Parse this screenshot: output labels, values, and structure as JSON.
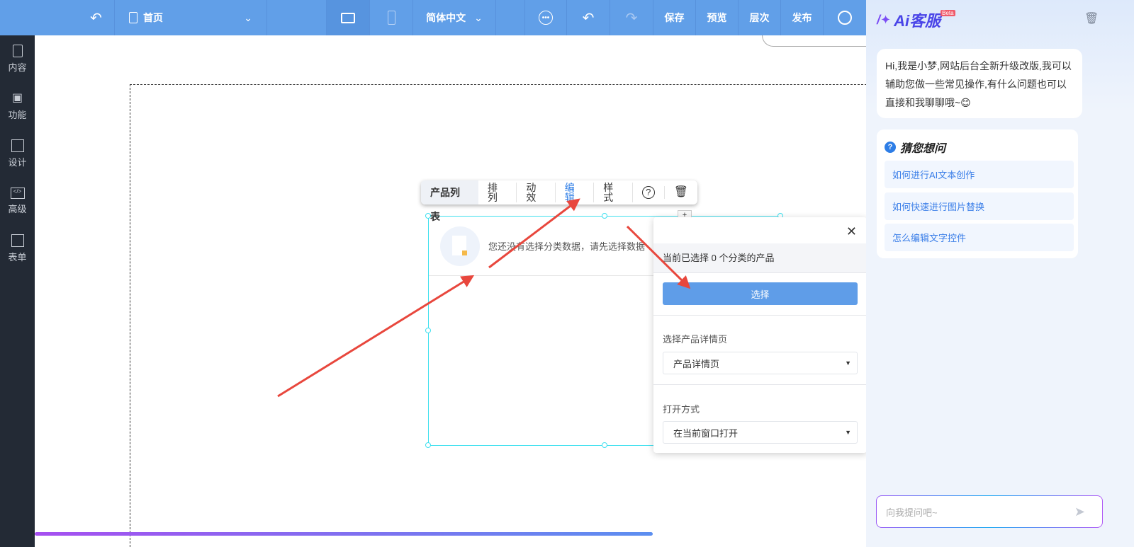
{
  "topbar": {
    "page": "首页",
    "language": "简体中文",
    "save": "保存",
    "preview": "预览",
    "layers": "层次",
    "publish": "发布"
  },
  "sidebar": {
    "items": [
      {
        "label": "内容"
      },
      {
        "label": "功能"
      },
      {
        "label": "设计"
      },
      {
        "label": "高级"
      },
      {
        "label": "表单"
      }
    ]
  },
  "toolbar": {
    "title": "产品列表",
    "items": [
      "排列",
      "动效",
      "编辑",
      "样式"
    ]
  },
  "component": {
    "empty_text": "您还没有选择分类数据，请先选择数据"
  },
  "popup": {
    "status": "当前已选择 0 个分类的产品",
    "select_button": "选择",
    "detail_label": "选择产品详情页",
    "detail_value": "产品详情页",
    "open_label": "打开方式",
    "open_value": "在当前窗口打开"
  },
  "assistant": {
    "title": "Ai客服",
    "badge": "Beta",
    "greeting": "Hi,我是小梦,网站后台全新升级改版,我可以辅助您做一些常见操作,有什么问题也可以直接和我聊聊哦~😊",
    "suggest_title": "猜您想问",
    "suggestions": [
      "如何进行AI文本创作",
      "如何快速进行图片替换",
      "怎么编辑文字控件"
    ],
    "input_placeholder": "向我提问吧~"
  },
  "colors": {
    "topbar": "#619fe8",
    "sidebar": "#232a35",
    "accent": "#3a7ee8",
    "arrow": "#e8473d"
  }
}
